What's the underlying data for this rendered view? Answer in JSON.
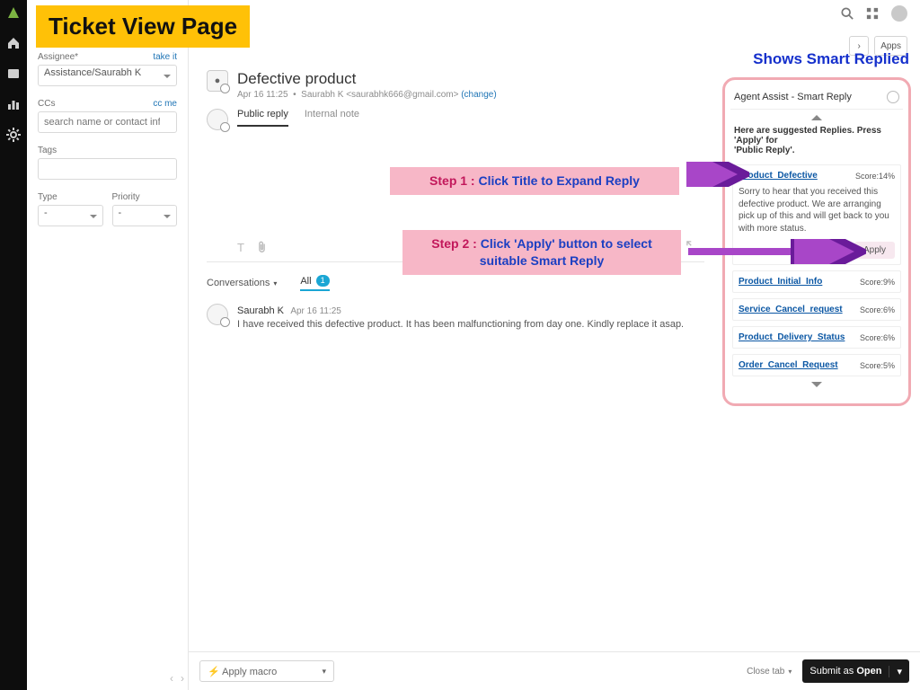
{
  "annotation": {
    "page_title": "Ticket View Page",
    "right_heading": "Shows Smart Replied",
    "step1_label": "Step 1 :",
    "step1_text": "Click Title to Expand Reply",
    "step2_label": "Step 2 :",
    "step2_text": "Click 'Apply' button to select suitable Smart Reply"
  },
  "topbar": {
    "apps_label": "Apps"
  },
  "ticket": {
    "title": "Defective product",
    "timestamp": "Apr 16 11:25",
    "requester_name": "Saurabh K",
    "requester_email": "<saurabhk666@gmail.com>",
    "change_link": "(change)"
  },
  "left": {
    "assignee_label": "Assignee*",
    "assignee_action": "take it",
    "assignee_value": "Assistance/Saurabh K",
    "cc_label": "CCs",
    "cc_action": "cc me",
    "cc_placeholder": "search name or contact info",
    "tags_label": "Tags",
    "type_label": "Type",
    "priority_label": "Priority",
    "type_value": "-",
    "priority_value": "-"
  },
  "composer": {
    "tab_public": "Public reply",
    "tab_internal": "Internal note",
    "text_glyph": "T"
  },
  "thread": {
    "conversations_label": "Conversations",
    "all_label": "All",
    "all_count": "1",
    "message_author": "Saurabh K",
    "message_time": "Apr 16 11:25",
    "message_body": "I have received this defective product. It has been malfunctioning from day one. Kindly replace it asap."
  },
  "footer": {
    "macro_label": "Apply macro",
    "close_tab": "Close tab",
    "submit_prefix": "Submit as",
    "submit_status": "Open"
  },
  "smart_reply": {
    "panel_title": "Agent Assist - Smart Reply",
    "hint_line1": "Here are suggested Replies. Press 'Apply' for",
    "hint_line2": "'Public Reply'.",
    "expanded": {
      "name": "Product_Defective",
      "score": "Score:14%",
      "body": "Sorry to hear that you received this defective product. We are arranging pick up of this and will get back to you with more status.",
      "apply": "Apply"
    },
    "items": [
      {
        "name": "Product_Initial_Info",
        "score": "Score:9%"
      },
      {
        "name": "Service_Cancel_request",
        "score": "Score:6%"
      },
      {
        "name": "Product_Delivery_Status",
        "score": "Score:6%"
      },
      {
        "name": "Order_Cancel_Request",
        "score": "Score:5%"
      }
    ]
  }
}
